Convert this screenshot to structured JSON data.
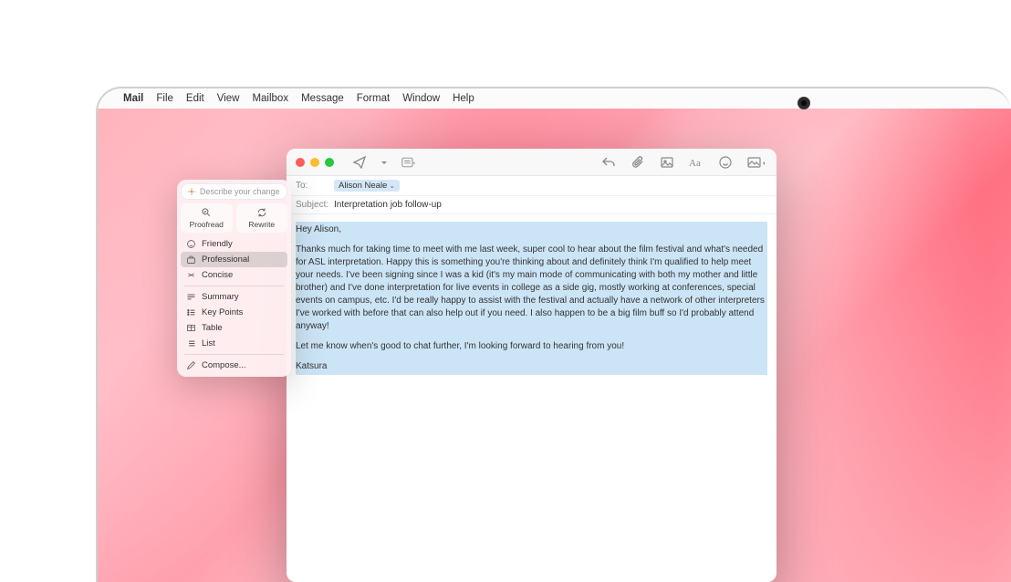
{
  "menubar": {
    "app": "Mail",
    "items": [
      "File",
      "Edit",
      "View",
      "Mailbox",
      "Message",
      "Format",
      "Window",
      "Help"
    ]
  },
  "ai_panel": {
    "placeholder": "Describe your change",
    "tabs": {
      "proofread": "Proofread",
      "rewrite": "Rewrite"
    },
    "tone_items": [
      {
        "icon": "smile",
        "label": "Friendly"
      },
      {
        "icon": "briefcase",
        "label": "Professional",
        "selected": true
      },
      {
        "icon": "compress",
        "label": "Concise"
      }
    ],
    "transform_items": [
      {
        "icon": "summary",
        "label": "Summary"
      },
      {
        "icon": "keypoints",
        "label": "Key Points"
      },
      {
        "icon": "table",
        "label": "Table"
      },
      {
        "icon": "list",
        "label": "List"
      }
    ],
    "compose": "Compose..."
  },
  "mail": {
    "headers": {
      "to_label": "To:",
      "recipient": "Alison Neale",
      "subject_label": "Subject:",
      "subject": "Interpretation job follow-up"
    },
    "body": {
      "greeting": "Hey Alison,",
      "para1": "Thanks much for taking time to meet with me last week, super cool to hear about the film festival and what's needed for ASL interpretation. Happy this is something you're thinking about and definitely think I'm qualified to help meet your needs. I've been signing since I was a kid (it's my main mode of communicating with both my mother and little brother) and I've done interpretation for  live events in college as a side gig, mostly working at conferences, special events on campus, etc. I'd be really happy to assist with the festival and actually have a network of other interpreters I've worked with before that can also help out if you need. I also happen to be a big film buff so I'd probably attend anyway!",
      "para2": "Let me know when's good to chat further, I'm looking forward to hearing from you!",
      "signature": "Katsura"
    }
  }
}
